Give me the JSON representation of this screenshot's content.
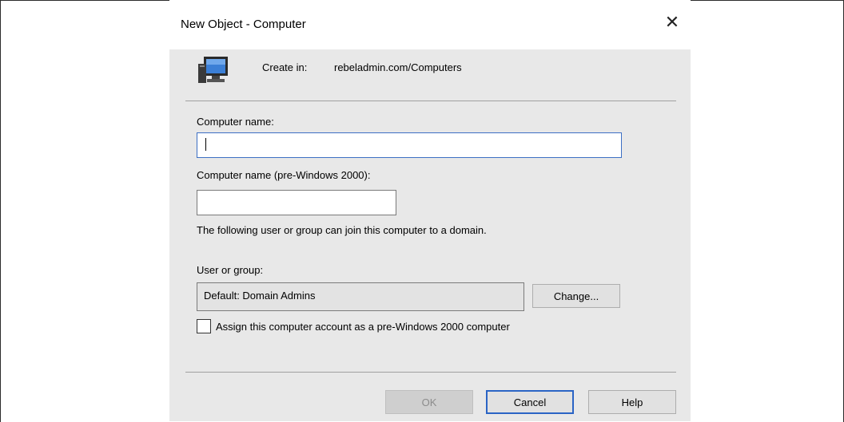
{
  "dialog": {
    "title": "New Object - Computer",
    "close_glyph": "✕"
  },
  "header": {
    "icon": "computer-monitor-icon",
    "create_in_label": "Create in:",
    "create_in_path": "rebeladmin.com/Computers"
  },
  "form": {
    "computer_name_label": "Computer name:",
    "computer_name_value": "",
    "pre2000_label": "Computer name (pre-Windows 2000):",
    "pre2000_value": "",
    "join_info": "The following user or group can join this computer to a domain.",
    "user_group_label": "User or group:",
    "user_group_value": "Default: Domain Admins",
    "change_button": "Change...",
    "checkbox_label": "Assign this computer account as a pre-Windows 2000 computer",
    "checkbox_checked": false
  },
  "buttons": {
    "ok": "OK",
    "cancel": "Cancel",
    "help": "Help"
  }
}
